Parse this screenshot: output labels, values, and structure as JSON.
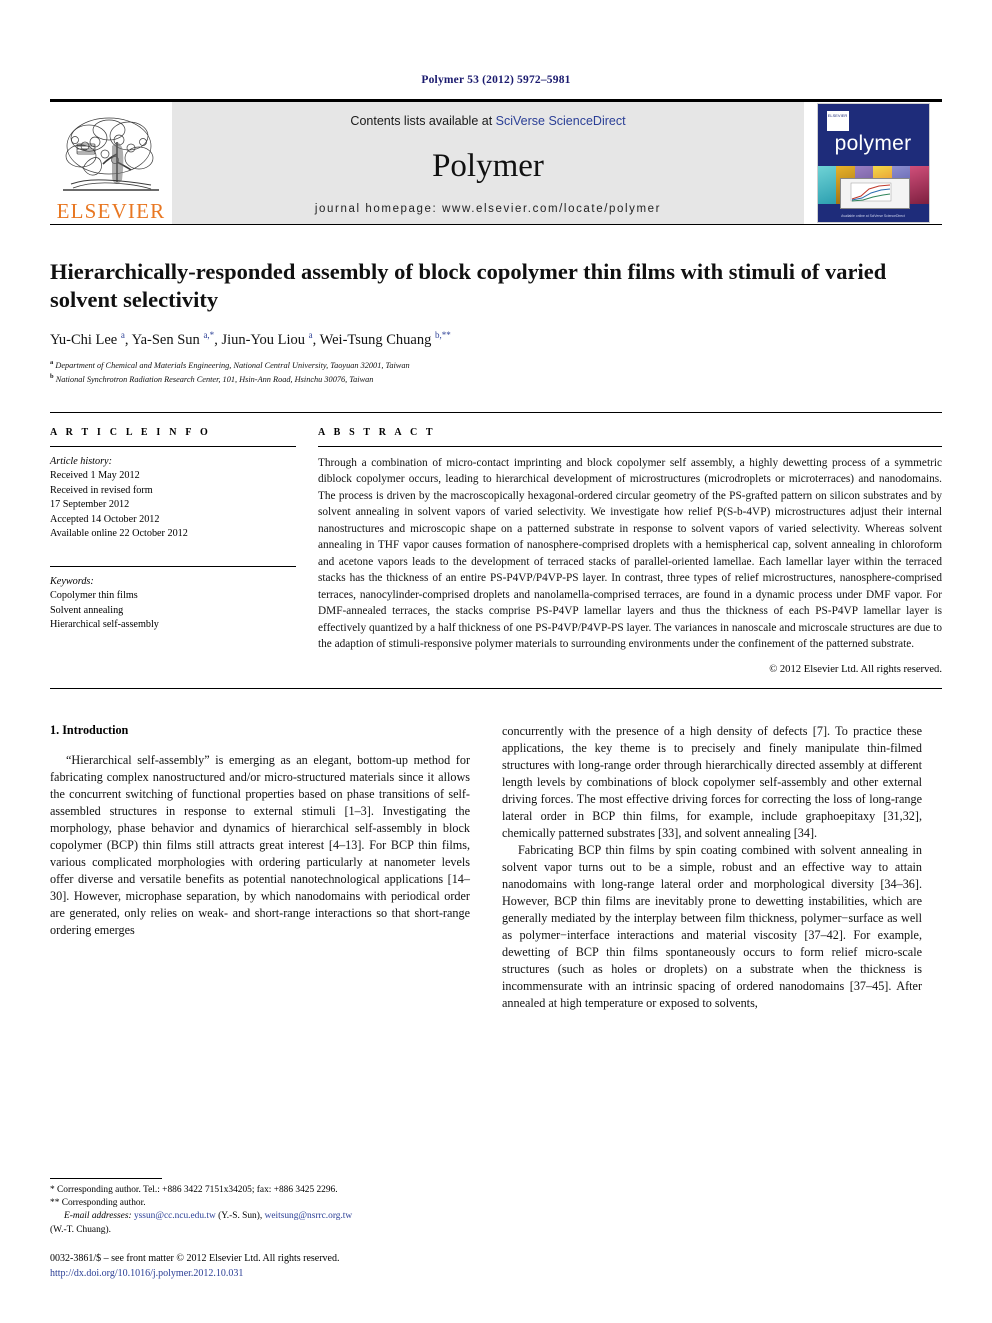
{
  "running_head": "Polymer 53 (2012) 5972–5981",
  "banner": {
    "publisher_name": "ELSEVIER",
    "contents_prefix": "Contents lists available at ",
    "contents_link": "SciVerse ScienceDirect",
    "journal_name": "Polymer",
    "homepage": "journal homepage: www.elsevier.com/locate/polymer",
    "cover": {
      "title": "polymer",
      "logo_text": "ELSEVIER",
      "footer": "Available online at\nSciVerse ScienceDirect"
    }
  },
  "article": {
    "title": "Hierarchically-responded assembly of block copolymer thin films with stimuli of varied solvent selectivity",
    "authors": "Yu-Chi Lee a, Ya-Sen Sun a,*, Jiun-You Liou a, Wei-Tsung Chuang b,**",
    "affiliations": [
      "a Department of Chemical and Materials Engineering, National Central University, Taoyuan 32001, Taiwan",
      "b National Synchrotron Radiation Research Center, 101, Hsin-Ann Road, Hsinchu 30076, Taiwan"
    ]
  },
  "article_info": {
    "heading": "A R T I C L E   I N F O",
    "history_label": "Article history:",
    "history": [
      "Received 1 May 2012",
      "Received in revised form",
      "17 September 2012",
      "Accepted 14 October 2012",
      "Available online 22 October 2012"
    ],
    "keywords_label": "Keywords:",
    "keywords": [
      "Copolymer thin films",
      "Solvent annealing",
      "Hierarchical self-assembly"
    ]
  },
  "abstract": {
    "heading": "A B S T R A C T",
    "text": "Through a combination of micro-contact imprinting and block copolymer self assembly, a highly dewetting process of a symmetric diblock copolymer occurs, leading to hierarchical development of microstructures (microdroplets or microterraces) and nanodomains. The process is driven by the macroscopically hexagonal-ordered circular geometry of the PS-grafted pattern on silicon substrates and by solvent annealing in solvent vapors of varied selectivity. We investigate how relief P(S-b-4VP) microstructures adjust their internal nanostructures and microscopic shape on a patterned substrate in response to solvent vapors of varied selectivity. Whereas solvent annealing in THF vapor causes formation of nanosphere-comprised droplets with a hemispherical cap, solvent annealing in chloroform and acetone vapors leads to the development of terraced stacks of parallel-oriented lamellae. Each lamellar layer within the terraced stacks has the thickness of an entire PS-P4VP/P4VP-PS layer. In contrast, three types of relief microstructures, nanosphere-comprised terraces, nanocylinder-comprised droplets and nanolamella-comprised terraces, are found in a dynamic process under DMF vapor. For DMF-annealed terraces, the stacks comprise PS-P4VP lamellar layers and thus the thickness of each PS-P4VP lamellar layer is effectively quantized by a half thickness of one PS-P4VP/P4VP-PS layer. The variances in nanoscale and microscale structures are due to the adaption of stimuli-responsive polymer materials to surrounding environments under the confinement of the patterned substrate.",
    "copyright": "© 2012 Elsevier Ltd. All rights reserved."
  },
  "intro": {
    "heading": "1.  Introduction",
    "left_paragraph_1": "“Hierarchical self-assembly” is emerging as an elegant, bottom-up method for fabricating complex nanostructured and/or micro-structured materials since it allows the concurrent switching of functional properties based on phase transitions of self-assembled structures in response to external stimuli [1–3]. Investigating the morphology, phase behavior and dynamics of hierarchical self-assembly in block copolymer (BCP) thin films still attracts great interest [4–13]. For BCP thin films, various complicated morphologies with ordering particularly at nanometer levels offer diverse and versatile benefits as potential nanotechnological applications [14–30]. However, microphase separation, by which nanodomains with periodical order are generated, only relies on weak- and short-range interactions so that short-range ordering emerges",
    "right_paragraph_1": "concurrently with the presence of a high density of defects [7]. To practice these applications, the key theme is to precisely and finely manipulate thin-filmed structures with long-range order through hierarchically directed assembly at different length levels by combinations of block copolymer self-assembly and other external driving forces. The most effective driving forces for correcting the loss of long-range lateral order in BCP thin films, for example, include graphoepitaxy [31,32], chemically patterned substrates [33], and solvent annealing [34].",
    "right_paragraph_2": "Fabricating BCP thin films by spin coating combined with solvent annealing in solvent vapor turns out to be a simple, robust and an effective way to attain nanodomains with long-range lateral order and morphological diversity [34–36]. However, BCP thin films are inevitably prone to dewetting instabilities, which are generally mediated by the interplay between film thickness, polymer−surface as well as polymer−interface interactions and material viscosity [37–42]. For example, dewetting of BCP thin films spontaneously occurs to form relief micro-scale structures (such as holes or droplets) on a substrate when the thickness is incommensurate with an intrinsic spacing of ordered nanodomains [37–45]. After annealed at high temperature or exposed to solvents,"
  },
  "footnotes": {
    "line1": "* Corresponding author. Tel.: +886 3422 7151x34205; fax: +886 3425 2296.",
    "line2": "** Corresponding author.",
    "email_label": "E-mail addresses:",
    "email1": "yssun@cc.ncu.edu.tw",
    "email1_owner": "(Y.-S. Sun),",
    "email2": "weitsung@nsrrc.org.tw",
    "email2_owner": "(W.-T. Chuang).",
    "imprint": "0032-3861/$ – see front matter © 2012 Elsevier Ltd. All rights reserved.",
    "doi": "http://dx.doi.org/10.1016/j.polymer.2012.10.031"
  },
  "colors": {
    "link": "#2b3f96",
    "elsevier_orange": "#E87722",
    "cover_blue": "#1e2c7a",
    "banner_gray": "#e6e6e6"
  }
}
